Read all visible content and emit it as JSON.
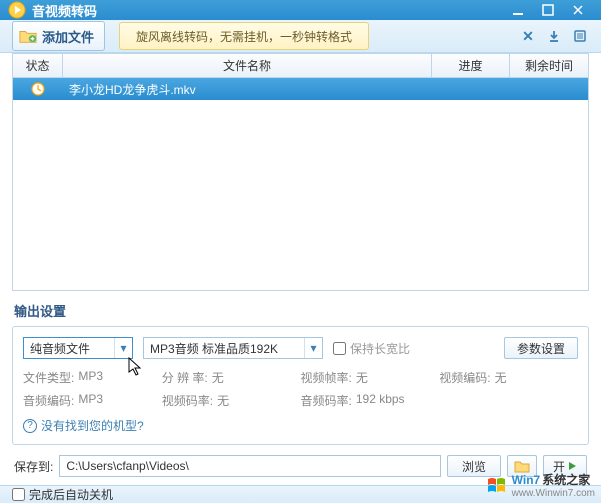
{
  "titlebar": {
    "title": "音视频转码"
  },
  "toolbar": {
    "add_label": "添加文件",
    "tip": "旋风离线转码，无需挂机，一秒钟转格式"
  },
  "table": {
    "headers": {
      "status": "状态",
      "name": "文件名称",
      "progress": "进度",
      "time": "剩余时间"
    },
    "rows": [
      {
        "name": "李小龙HD龙争虎斗.mkv",
        "progress": "",
        "time": ""
      }
    ]
  },
  "output": {
    "section_label": "输出设置",
    "combo1": "纯音频文件",
    "combo2": "MP3音频 标准品质192K",
    "keep_ratio": "保持长宽比",
    "param_btn": "参数设置",
    "info": {
      "file_type_lbl": "文件类型:",
      "file_type_val": "MP3",
      "resolution_lbl": "分 辨 率:",
      "resolution_val": "无",
      "video_fps_lbl": "视频帧率:",
      "video_fps_val": "无",
      "video_codec_lbl": "视频编码:",
      "video_codec_val": "无",
      "audio_codec_lbl": "音频编码:",
      "audio_codec_val": "MP3",
      "video_bitrate_lbl": "视频码率:",
      "video_bitrate_val": "无",
      "audio_bitrate_lbl": "音频码率:",
      "audio_bitrate_val": "192 kbps"
    },
    "help": "没有找到您的机型?"
  },
  "save": {
    "label": "保存到:",
    "path": "C:\\Users\\cfanp\\Videos\\",
    "browse": "浏览",
    "start": "开"
  },
  "footer": {
    "auto_shutdown": "完成后自动关机"
  },
  "watermark": {
    "brand1": "Win7",
    "brand2": "系统之家",
    "url": "www.Winwin7.com"
  }
}
